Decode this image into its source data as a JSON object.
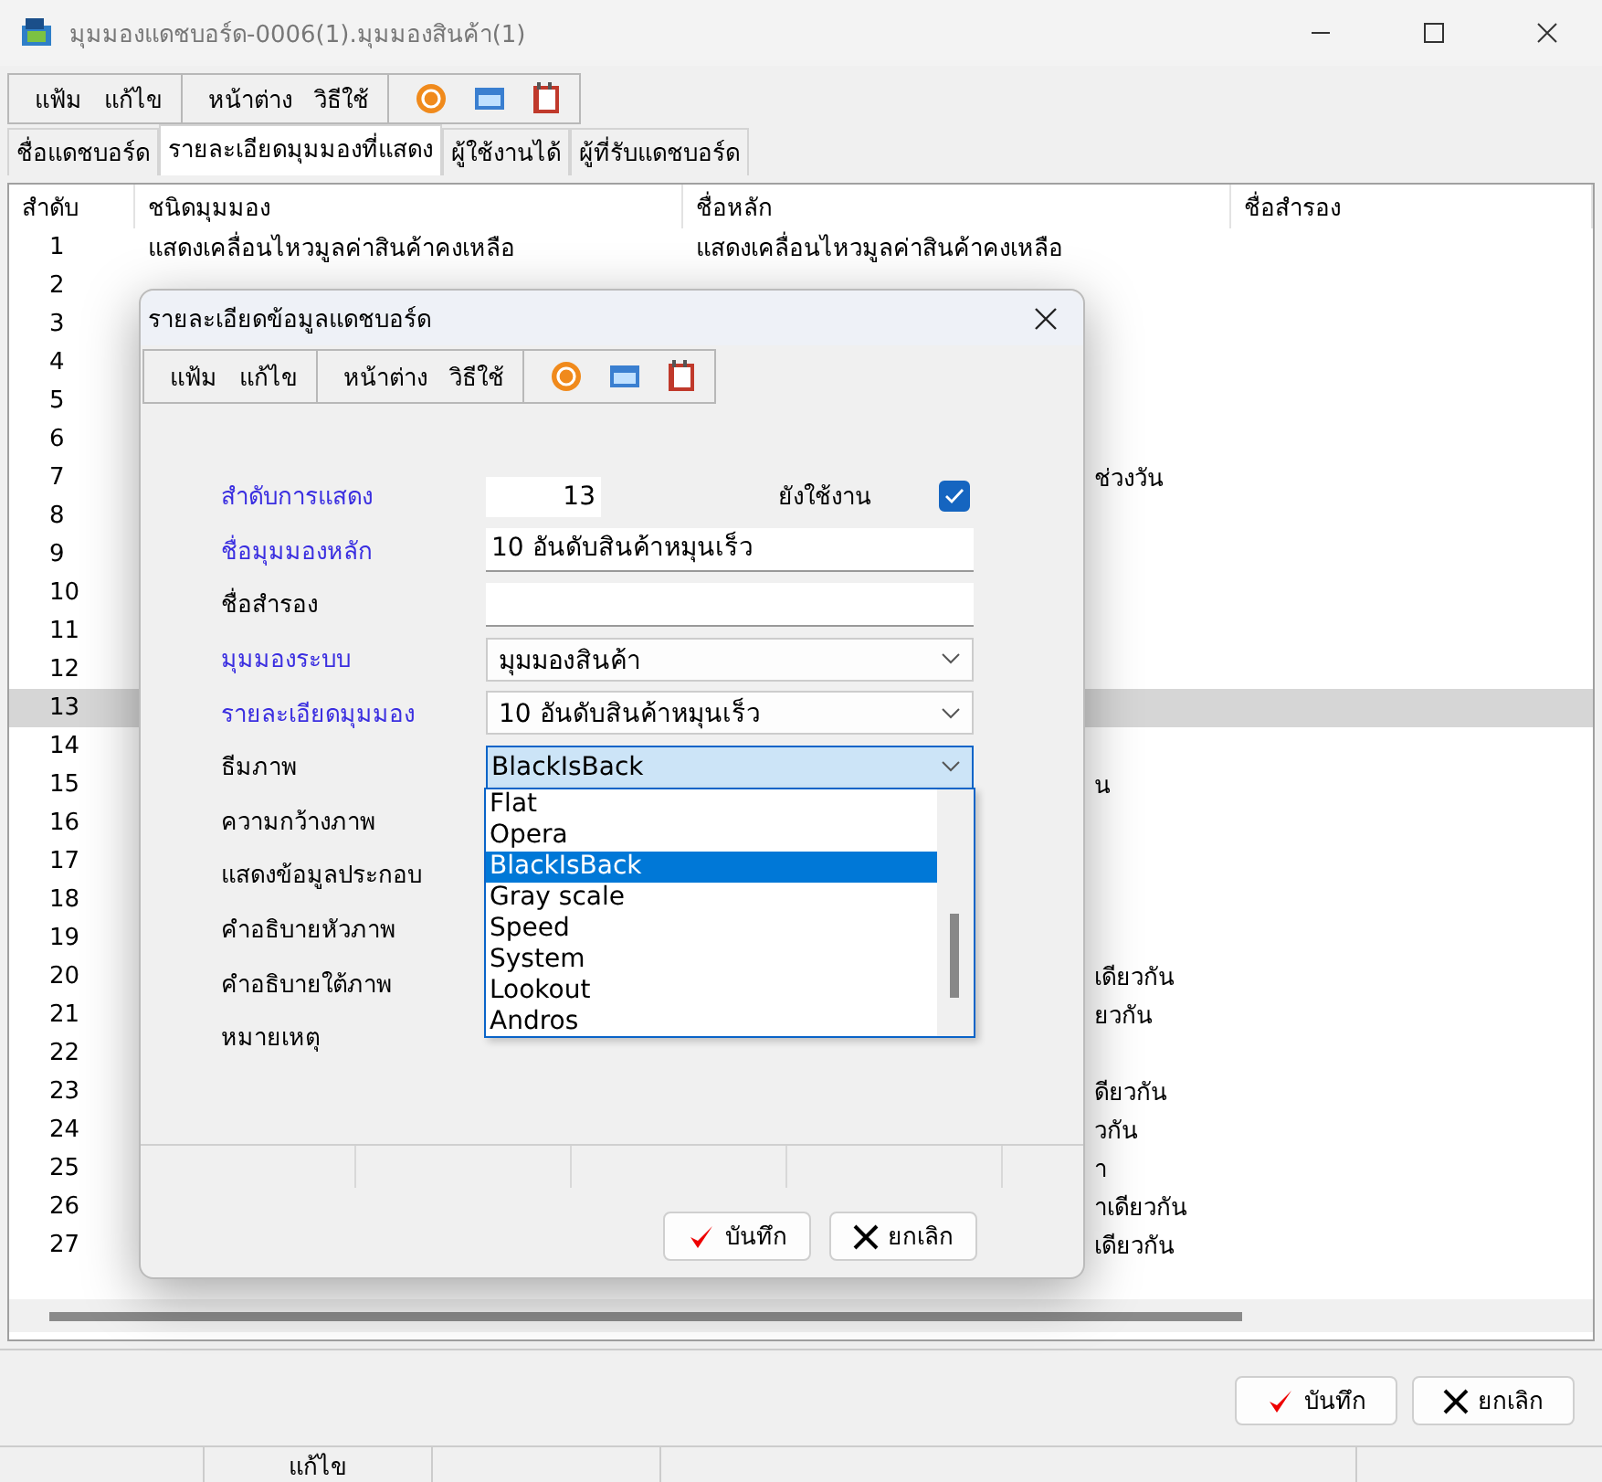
{
  "window": {
    "title": "มุมมองแดชบอร์ด-0006(1).มุมมองสินค้า(1)"
  },
  "menus": [
    [
      "แฟ้ม",
      "แก้ไข"
    ],
    [
      "หน้าต่าง",
      "วิธีใช้"
    ]
  ],
  "tabs": [
    {
      "label": "ชื่อแดชบอร์ด",
      "selected": false
    },
    {
      "label": "รายละเอียดมุมมองที่แสดง",
      "selected": true
    },
    {
      "label": "ผู้ใช้งานได้",
      "selected": false
    },
    {
      "label": "ผู้ที่รับแดชบอร์ด",
      "selected": false
    }
  ],
  "table": {
    "columns": [
      "สำดับ",
      "ชนิดมุมมอง",
      "ชื่อหลัก",
      "ชื่อสำรอง"
    ],
    "rows": [
      {
        "number": "1",
        "view_type": "แสดงเคลื่อนไหวมูลค่าสินค้าคงเหลือ",
        "main_name": "แสดงเคลื่อนไหวมูลค่าสินค้าคงเหลือ",
        "selected": false
      },
      {
        "number": "2",
        "selected": false
      },
      {
        "number": "3",
        "selected": false
      },
      {
        "number": "4",
        "selected": false
      },
      {
        "number": "5",
        "selected": false
      },
      {
        "number": "6",
        "selected": false
      },
      {
        "number": "7",
        "main_name": "ช่วงวัน",
        "clipped": true,
        "selected": false
      },
      {
        "number": "8",
        "selected": false
      },
      {
        "number": "9",
        "selected": false
      },
      {
        "number": "10",
        "selected": false
      },
      {
        "number": "11",
        "selected": false
      },
      {
        "number": "12",
        "selected": false
      },
      {
        "number": "13",
        "selected": true
      },
      {
        "number": "14",
        "selected": false
      },
      {
        "number": "15",
        "main_name": "น",
        "clipped": true,
        "selected": false
      },
      {
        "number": "16",
        "selected": false
      },
      {
        "number": "17",
        "selected": false
      },
      {
        "number": "18",
        "selected": false
      },
      {
        "number": "19",
        "selected": false
      },
      {
        "number": "20",
        "main_name": "เดียวกัน",
        "clipped": true,
        "selected": false
      },
      {
        "number": "21",
        "main_name": "ยวกัน",
        "clipped": true,
        "selected": false
      },
      {
        "number": "22",
        "selected": false
      },
      {
        "number": "23",
        "main_name": "ดียวกัน",
        "clipped": true,
        "selected": false
      },
      {
        "number": "24",
        "main_name": "วกัน",
        "clipped": true,
        "selected": false
      },
      {
        "number": "25",
        "main_name": "า",
        "clipped": true,
        "selected": false
      },
      {
        "number": "26",
        "main_name": "าเดียวกัน",
        "clipped": true,
        "selected": false
      },
      {
        "number": "27",
        "main_name": "เดียวกัน",
        "clipped": true,
        "selected": false
      }
    ]
  },
  "buttons": [
    {
      "label": "บันทึก",
      "kind": "save"
    },
    {
      "label": "ยกเลิก",
      "kind": "cancel"
    }
  ],
  "status_bar": {
    "mode": "แก้ไข"
  },
  "dialog": {
    "title": "รายละเอียดข้อมูลแดชบอร์ด",
    "menus": [
      [
        "แฟ้ม",
        "แก้ไข"
      ],
      [
        "หน้าต่าง",
        "วิธีใช้"
      ]
    ],
    "order": {
      "label": "สำดับการแสดง",
      "value": "13",
      "required": true
    },
    "active": {
      "label": "ยังใช้งาน",
      "checked": true
    },
    "fields": [
      {
        "label": "ชื่อมุมมองหลัก",
        "required": true,
        "kind": "text",
        "value": "10 อันดับสินค้าหมุนเร็ว"
      },
      {
        "label": "ชื่อสำรอง",
        "required": false,
        "kind": "text"
      },
      {
        "label": "มุมมองระบบ",
        "required": true,
        "kind": "select",
        "value": "มุมมองสินค้า"
      },
      {
        "label": "รายละเอียดมุมมอง",
        "required": true,
        "kind": "select",
        "value": "10 อันดับสินค้าหมุนเร็ว"
      },
      {
        "label": "ธีมภาพ",
        "required": false,
        "kind": "select",
        "value": "BlackIsBack",
        "open": true
      },
      {
        "label": "ความกว้างภาพ",
        "required": false,
        "kind": "covered"
      },
      {
        "label": "แสดงข้อมูลประกอบ",
        "required": false,
        "kind": "covered"
      },
      {
        "label": "คำอธิบายหัวภาพ",
        "required": false,
        "kind": "covered"
      },
      {
        "label": "คำอธิบายใต้ภาพ",
        "required": false,
        "kind": "covered"
      },
      {
        "label": "หมายเหตุ",
        "required": false,
        "kind": "covered"
      }
    ],
    "options": [
      {
        "label": "Flat",
        "selected": false
      },
      {
        "label": "Opera",
        "selected": false
      },
      {
        "label": "BlackIsBack",
        "selected": true
      },
      {
        "label": "Gray scale",
        "selected": false
      },
      {
        "label": "Speed",
        "selected": false
      },
      {
        "label": "System",
        "selected": false
      },
      {
        "label": "Lookout",
        "selected": false
      },
      {
        "label": "Andros",
        "selected": false
      }
    ],
    "buttons": [
      {
        "label": "บันทึก",
        "kind": "save"
      },
      {
        "label": "ยกเลิก",
        "kind": "cancel"
      }
    ]
  }
}
